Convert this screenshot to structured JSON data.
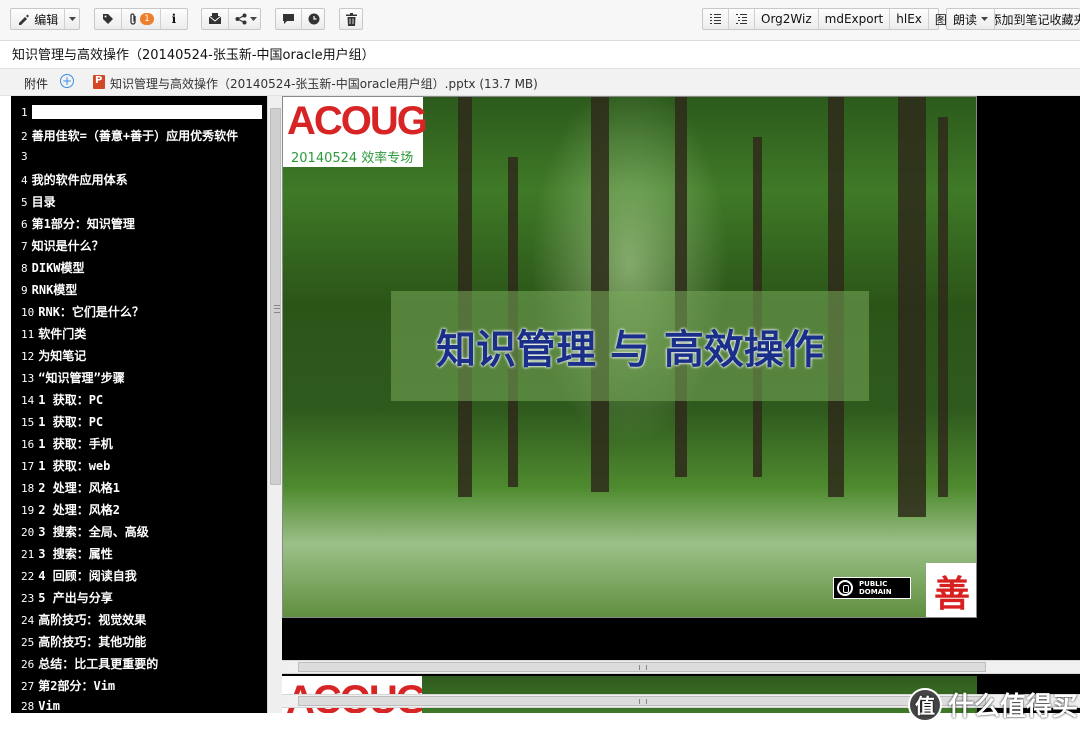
{
  "toolbar": {
    "edit_label": "编辑",
    "attachment_count": "1",
    "info_label": "i",
    "plugins": [
      "Org2Wiz",
      "mdExport",
      "hlEx",
      "图片盒"
    ],
    "read_label": "朗读",
    "add_favorites_label": "添加到笔记收藏夹"
  },
  "note": {
    "title": "知识管理与高效操作（20140524-张玉新-中国oracle用户组）"
  },
  "attachments": {
    "label": "附件",
    "file_name": "知识管理与高效操作（20140524-张玉新-中国oracle用户组）.pptx (13.7 MB)"
  },
  "outline": [
    {
      "num": "1",
      "text": ""
    },
    {
      "num": "2",
      "text": "善用佳软=（善意+善于）应用优秀软件"
    },
    {
      "num": "3",
      "text": ""
    },
    {
      "num": "4",
      "text": "我的软件应用体系"
    },
    {
      "num": "5",
      "text": "目录"
    },
    {
      "num": "6",
      "text": "第1部分：知识管理"
    },
    {
      "num": "7",
      "text": "知识是什么？"
    },
    {
      "num": "8",
      "text": "DIKW模型"
    },
    {
      "num": "9",
      "text": "RNK模型"
    },
    {
      "num": "10",
      "text": "RNK：它们是什么？"
    },
    {
      "num": "11",
      "text": "软件门类"
    },
    {
      "num": "12",
      "text": "为知笔记"
    },
    {
      "num": "13",
      "text": "“知识管理”步骤"
    },
    {
      "num": "14",
      "text": "1 获取：PC"
    },
    {
      "num": "15",
      "text": "1 获取：PC"
    },
    {
      "num": "16",
      "text": "1 获取：手机"
    },
    {
      "num": "17",
      "text": "1 获取：web"
    },
    {
      "num": "18",
      "text": "2 处理：风格1"
    },
    {
      "num": "19",
      "text": "2 处理：风格2"
    },
    {
      "num": "20",
      "text": "3 搜索：全局、高级"
    },
    {
      "num": "21",
      "text": "3 搜索：属性"
    },
    {
      "num": "22",
      "text": "4 回顾：阅读自我"
    },
    {
      "num": "23",
      "text": "5 产出与分享"
    },
    {
      "num": "24",
      "text": "高阶技巧：视觉效果"
    },
    {
      "num": "25",
      "text": "高阶技巧：其他功能"
    },
    {
      "num": "26",
      "text": "总结：比工具更重要的"
    },
    {
      "num": "27",
      "text": "第2部分：Vim"
    },
    {
      "num": "28",
      "text": "Vim"
    }
  ],
  "slide": {
    "logo": "ACOUG",
    "logo_sub": "20140524 效率专场",
    "title": "知识管理 与 高效操作",
    "cc_line1": "PUBLIC",
    "cc_line2": "DOMAIN",
    "seal": "善"
  },
  "slide2": {
    "logo": "ACOUG"
  },
  "watermark": {
    "icon_text": "值",
    "text": "什么值得买"
  },
  "colors": {
    "accent_red": "#d72525",
    "banner_text": "#1a2f8a",
    "badge": "#f07d2a"
  }
}
